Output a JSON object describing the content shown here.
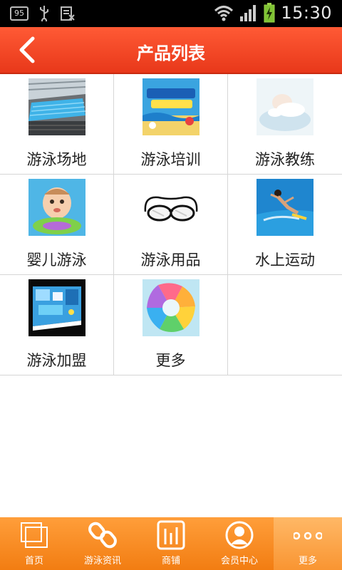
{
  "status": {
    "time": "15:30",
    "badge": "95"
  },
  "header": {
    "title": "产品列表"
  },
  "products": [
    {
      "label": "游泳场地",
      "icon": "pool-venue-image"
    },
    {
      "label": "游泳培训",
      "icon": "swim-training-image"
    },
    {
      "label": "游泳教练",
      "icon": "swim-coach-image"
    },
    {
      "label": "婴儿游泳",
      "icon": "baby-swim-image"
    },
    {
      "label": "游泳用品",
      "icon": "goggles-image"
    },
    {
      "label": "水上运动",
      "icon": "water-sport-image"
    },
    {
      "label": "游泳加盟",
      "icon": "franchise-image"
    },
    {
      "label": "更多",
      "icon": "more-colorful-image"
    }
  ],
  "nav": [
    {
      "label": "首页",
      "icon": "home-icon"
    },
    {
      "label": "游泳资讯",
      "icon": "link-icon"
    },
    {
      "label": "商铺",
      "icon": "shop-icon"
    },
    {
      "label": "会员中心",
      "icon": "member-icon"
    },
    {
      "label": "更多",
      "icon": "more-icon"
    }
  ],
  "colors": {
    "header": "#e8381a",
    "nav": "#f27d12",
    "nav_active": "#ffb866"
  }
}
